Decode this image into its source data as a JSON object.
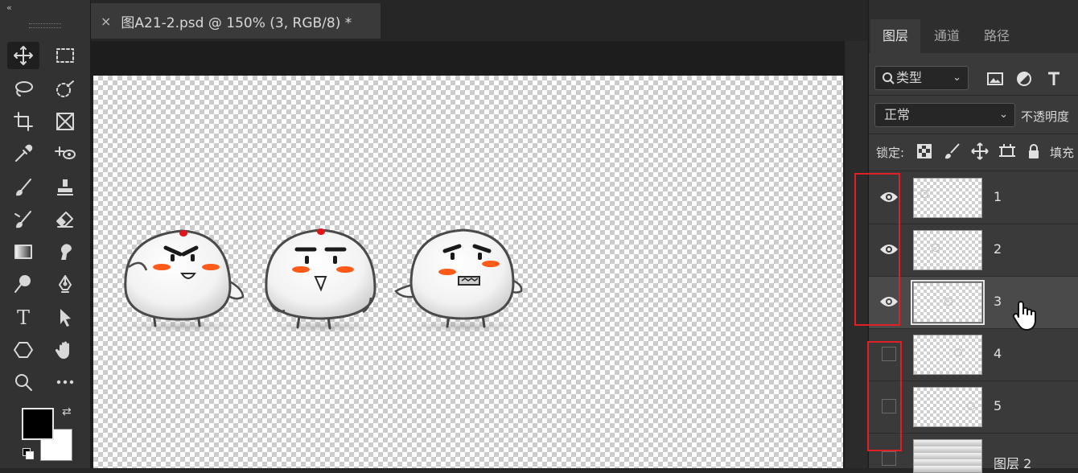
{
  "document": {
    "tab_close": "×",
    "tab_title": "图A21-2.psd @ 150% (3, RGB/8) *"
  },
  "toolbar": {
    "collapse_glyph": "‹‹",
    "type_tool_glyph": "T",
    "swap_glyph": "⇄",
    "foreground_color": "#000000",
    "background_color": "#ffffff"
  },
  "panel": {
    "tabs": [
      "图层",
      "通道",
      "路径"
    ],
    "active_tab": 0,
    "filter": {
      "label": "类型",
      "chevron": "⌄"
    },
    "blend_mode": {
      "value": "正常",
      "chevron": "⌄"
    },
    "opacity_label": "不透明度",
    "lock_label": "锁定:",
    "fill_label": "填充",
    "layers": [
      {
        "name": "1",
        "visible": true,
        "selected": false
      },
      {
        "name": "2",
        "visible": true,
        "selected": false
      },
      {
        "name": "3",
        "visible": true,
        "selected": true
      },
      {
        "name": "4",
        "visible": false,
        "selected": false
      },
      {
        "name": "5",
        "visible": false,
        "selected": false
      },
      {
        "name": "图层 2",
        "visible": false,
        "selected": false
      }
    ]
  },
  "colors": {
    "highlight_red": "#e01f26",
    "cheek_orange": "#ff5a1a",
    "topknot_red": "#e0141a"
  }
}
